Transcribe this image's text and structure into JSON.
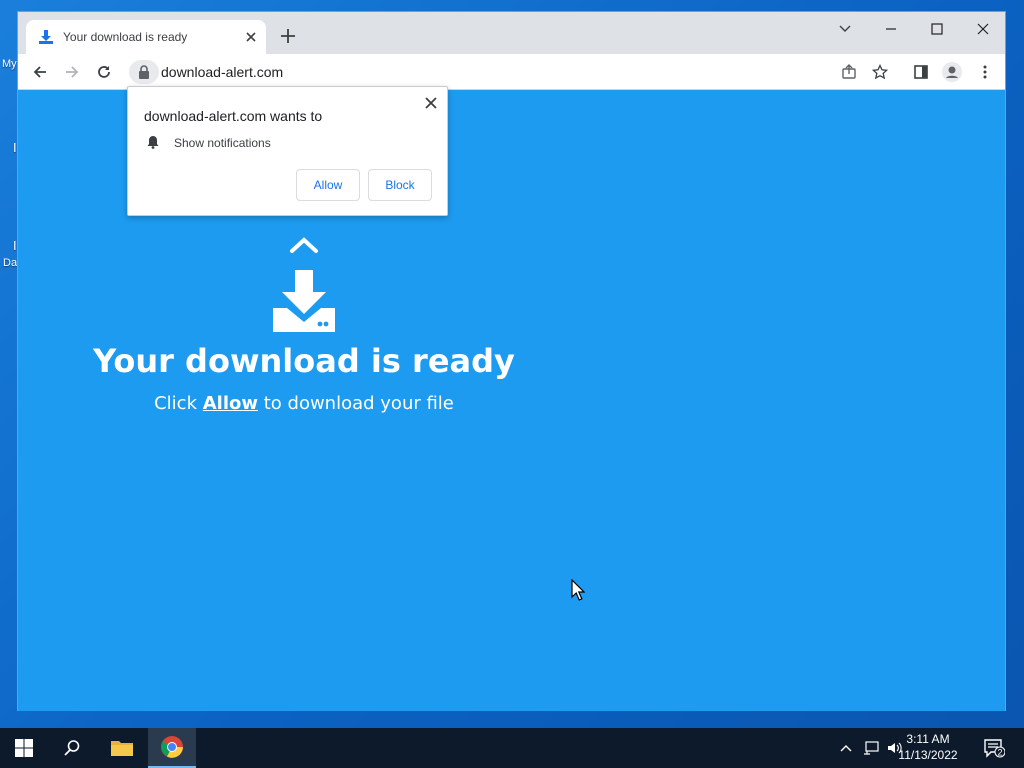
{
  "desktop": {
    "icons": [
      "My",
      "I",
      "I",
      "Da"
    ]
  },
  "browser": {
    "tab": {
      "title": "Your download is ready"
    },
    "url": "download-alert.com"
  },
  "page": {
    "headline": "Your download is ready",
    "sub_prefix": "Click ",
    "sub_link": "Allow",
    "sub_suffix": " to download your file"
  },
  "prompt": {
    "title": "download-alert.com wants to",
    "permission": "Show notifications",
    "allow_label": "Allow",
    "block_label": "Block"
  },
  "taskbar": {
    "time": "3:11 AM",
    "date": "11/13/2022",
    "notification_count": "2"
  },
  "colors": {
    "page_bg": "#1d9bf0",
    "accent": "#1a73e8"
  }
}
